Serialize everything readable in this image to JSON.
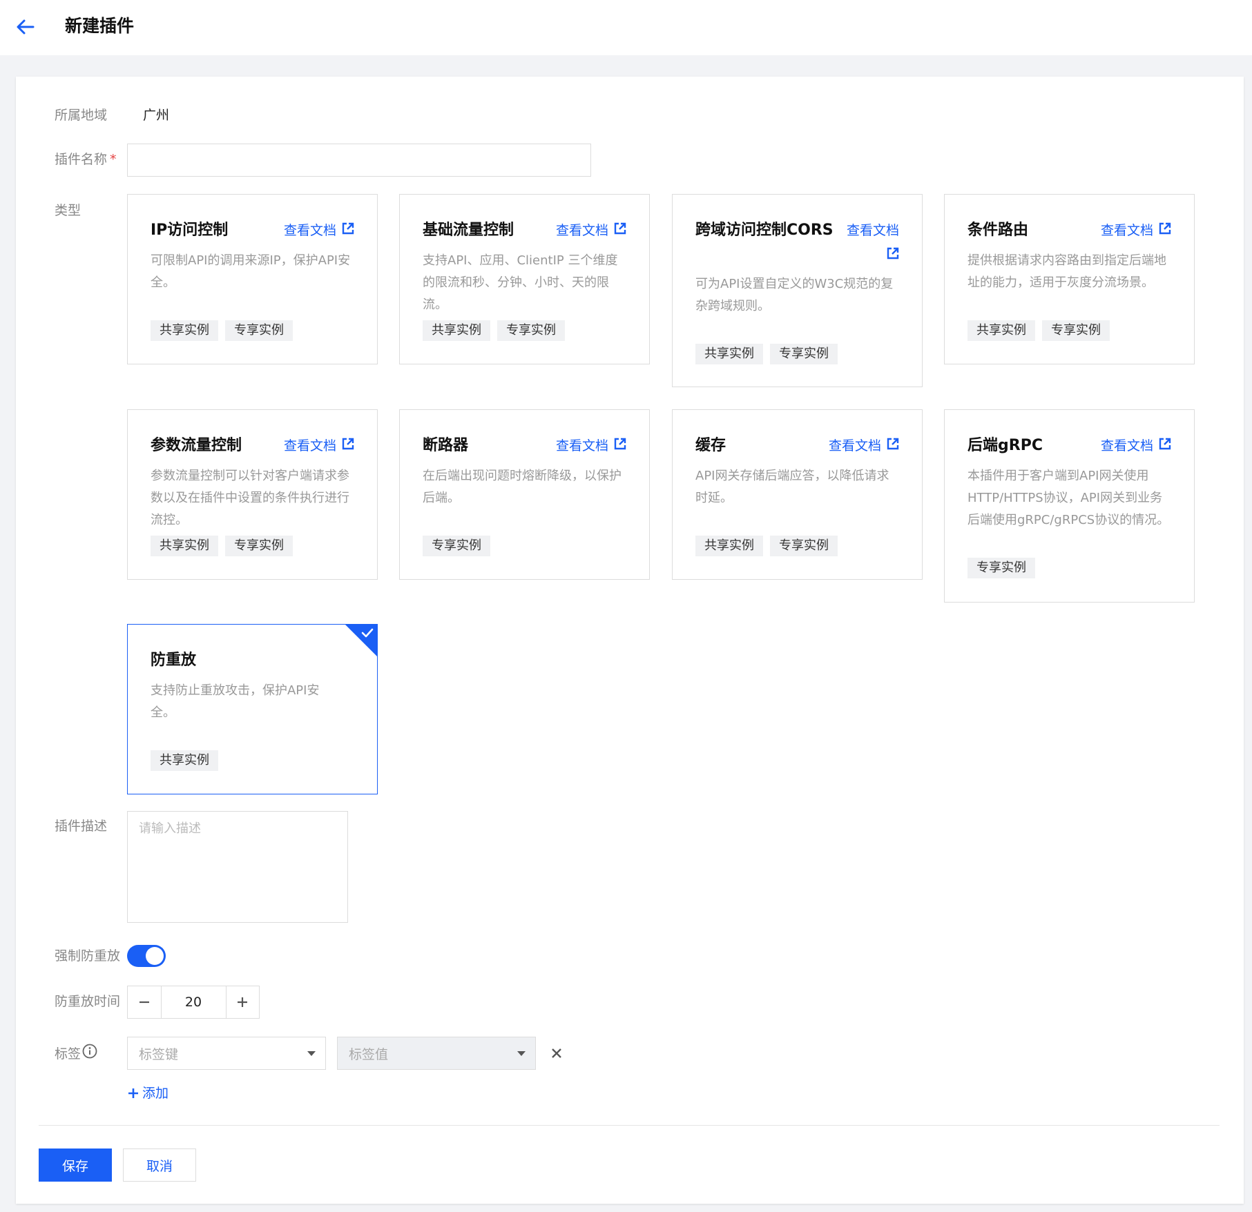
{
  "header": {
    "title": "新建插件"
  },
  "form": {
    "region_label": "所属地域",
    "region_value": "广州",
    "name_label": "插件名称",
    "required_mark": "*",
    "name_value": "",
    "type_label": "类型",
    "desc_label": "插件描述",
    "desc_placeholder": "请输入描述",
    "force_label": "强制防重放",
    "force_enabled": true,
    "time_label": "防重放时间",
    "time_value": "20",
    "tag_label": "标签",
    "tag_key_placeholder": "标签键",
    "tag_value_placeholder": "标签值",
    "add_label": "添加",
    "save_label": "保存",
    "cancel_label": "取消"
  },
  "doc_link_label": "查看文档",
  "cards": [
    {
      "title": "IP访问控制",
      "desc": "可限制API的调用来源IP，保护API安全。",
      "tags": [
        "共享实例",
        "专享实例"
      ]
    },
    {
      "title": "基础流量控制",
      "desc": "支持API、应用、ClientIP 三个维度的限流和秒、分钟、小时、天的限流。",
      "tags": [
        "共享实例",
        "专享实例"
      ]
    },
    {
      "title": "跨域访问控制CORS",
      "desc": "可为API设置自定义的W3C规范的复杂跨域规则。",
      "tags": [
        "共享实例",
        "专享实例"
      ]
    },
    {
      "title": "条件路由",
      "desc": "提供根据请求内容路由到指定后端地址的能力，适用于灰度分流场景。",
      "tags": [
        "共享实例",
        "专享实例"
      ]
    },
    {
      "title": "参数流量控制",
      "desc": "参数流量控制可以针对客户端请求参数以及在插件中设置的条件执行进行流控。",
      "tags": [
        "共享实例",
        "专享实例"
      ]
    },
    {
      "title": "断路器",
      "desc": "在后端出现问题时熔断降级，以保护后端。",
      "tags": [
        "专享实例"
      ]
    },
    {
      "title": "缓存",
      "desc": "API网关存储后端应答，以降低请求时延。",
      "tags": [
        "共享实例",
        "专享实例"
      ]
    },
    {
      "title": "后端gRPC",
      "desc": "本插件用于客户端到API网关使用HTTP/HTTPS协议，API网关到业务后端使用gRPC/gRPCS协议的情况。",
      "tags": [
        "专享实例"
      ]
    },
    {
      "title": "防重放",
      "desc": "支持防止重放攻击，保护API安全。",
      "tags": [
        "共享实例"
      ],
      "selected": true
    }
  ],
  "colors": {
    "accent": "#1a5ff5",
    "required": "#e54545",
    "tag_bg": "#f0f1f3"
  },
  "icons": [
    "arrow-left-icon",
    "external-link-icon",
    "check-icon",
    "info-icon",
    "minus-icon",
    "plus-icon",
    "caret-down-icon",
    "close-icon"
  ]
}
